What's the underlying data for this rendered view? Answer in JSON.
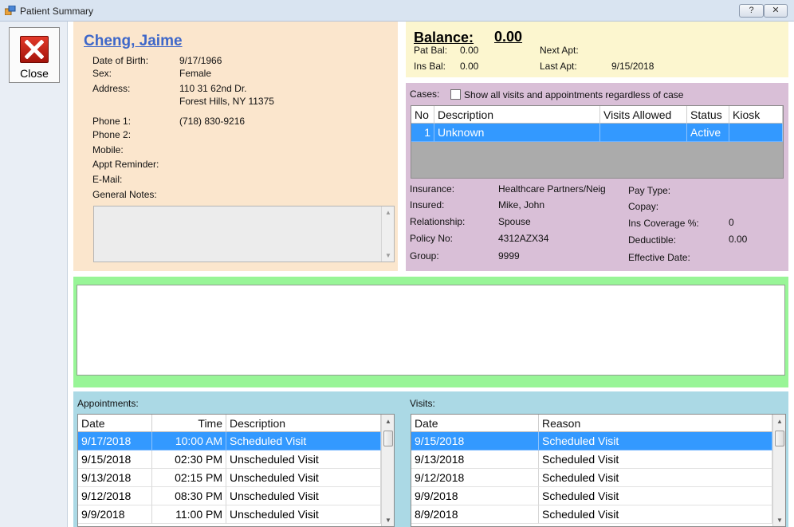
{
  "window": {
    "title": "Patient Summary",
    "help_glyph": "?",
    "close_glyph": "✕"
  },
  "close_button": {
    "label": "Close"
  },
  "patient": {
    "name": "Cheng, Jaime",
    "labels": {
      "dob": "Date of Birth:",
      "sex": "Sex:",
      "address": "Address:",
      "phone1": "Phone 1:",
      "phone2": "Phone 2:",
      "mobile": "Mobile:",
      "appt_reminder": "Appt Reminder:",
      "email": "E-Mail:",
      "general_notes": "General Notes:"
    },
    "values": {
      "dob": "9/17/1966",
      "sex": "Female",
      "address1": "110 31 62nd Dr.",
      "address2": "Forest Hills, NY 11375",
      "phone1": "(718) 830-9216"
    }
  },
  "balance": {
    "title": "Balance:",
    "value": "0.00",
    "pat_bal_label": "Pat Bal:",
    "pat_bal": "0.00",
    "ins_bal_label": "Ins Bal:",
    "ins_bal": "0.00",
    "next_apt_label": "Next Apt:",
    "next_apt": "",
    "last_apt_label": "Last Apt:",
    "last_apt": "9/15/2018"
  },
  "cases": {
    "label": "Cases:",
    "show_all_label": "Show all visits and appointments regardless of case",
    "columns": [
      "No",
      "Description",
      "Visits Allowed",
      "Status",
      "Kiosk"
    ],
    "rows": [
      {
        "no": "1",
        "description": "Unknown",
        "visits_allowed": "",
        "status": "Active",
        "kiosk": ""
      }
    ]
  },
  "insurance": {
    "labels": {
      "insurance": "Insurance:",
      "insured": "Insured:",
      "relationship": "Relationship:",
      "policy_no": "Policy No:",
      "group": "Group:",
      "pay_type": "Pay Type:",
      "copay": "Copay:",
      "ins_coverage": "Ins Coverage %:",
      "deductible": "Deductible:",
      "effective_date": "Effective Date:"
    },
    "values": {
      "insurance": "Healthcare Partners/Neig",
      "insured": "Mike, John",
      "relationship": "Spouse",
      "policy_no": "4312AZX34",
      "group": "9999",
      "ins_coverage": "0",
      "deductible": "0.00"
    }
  },
  "appointments": {
    "label": "Appointments:",
    "columns": [
      "Date",
      "Time",
      "Description"
    ],
    "rows": [
      {
        "date": "9/17/2018",
        "time": "10:00 AM",
        "description": "Scheduled Visit"
      },
      {
        "date": "9/15/2018",
        "time": "02:30 PM",
        "description": "Unscheduled Visit"
      },
      {
        "date": "9/13/2018",
        "time": "02:15 PM",
        "description": "Unscheduled Visit"
      },
      {
        "date": "9/12/2018",
        "time": "08:30 PM",
        "description": "Unscheduled Visit"
      },
      {
        "date": "9/9/2018",
        "time": "11:00 PM",
        "description": "Unscheduled Visit"
      }
    ]
  },
  "visits": {
    "label": "Visits:",
    "columns": [
      "Date",
      "Reason"
    ],
    "rows": [
      {
        "date": "9/15/2018",
        "reason": "Scheduled Visit"
      },
      {
        "date": "9/13/2018",
        "reason": "Scheduled Visit"
      },
      {
        "date": "9/12/2018",
        "reason": "Scheduled Visit"
      },
      {
        "date": "9/9/2018",
        "reason": "Scheduled Visit"
      },
      {
        "date": "8/9/2018",
        "reason": "Scheduled Visit"
      }
    ]
  },
  "colors": {
    "patient_panel": "#fbe6cd",
    "balance_panel": "#fcf6cf",
    "case_panel": "#d9bfd7",
    "notes_panel": "#98f597",
    "appt_panel": "#abd9e5",
    "selection": "#3399ff",
    "name_link": "#3e67c9"
  }
}
